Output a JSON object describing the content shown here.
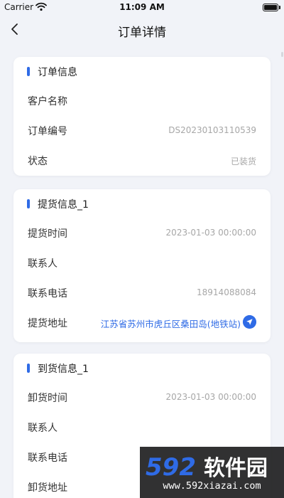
{
  "status_bar": {
    "carrier": "Carrier",
    "time": "11:09 AM",
    "wifi_icon": "wifi-icon",
    "battery_icon": "battery-icon"
  },
  "nav": {
    "title": "订单详情",
    "back_icon": "chevron-left-icon"
  },
  "order_info": {
    "title": "订单信息",
    "rows": [
      {
        "label": "客户名称",
        "value": ""
      },
      {
        "label": "订单编号",
        "value": "DS20230103110539"
      },
      {
        "label": "状态",
        "value": "已装货"
      }
    ]
  },
  "pickup_info": {
    "title": "提货信息_1",
    "rows": [
      {
        "label": "提货时间",
        "value": "2023-01-03 00:00:00"
      },
      {
        "label": "联系人",
        "value": ""
      },
      {
        "label": "联系电话",
        "value": "18914088084"
      },
      {
        "label": "提货地址",
        "value": "江苏省苏州市虎丘区桑田岛(地铁站)",
        "icon": "navigation-arrow-icon"
      }
    ]
  },
  "delivery_info": {
    "title": "到货信息_1",
    "rows": [
      {
        "label": "卸货时间",
        "value": "2023-01-03 00:00:00"
      },
      {
        "label": "联系人",
        "value": ""
      },
      {
        "label": "联系电话",
        "value": ""
      },
      {
        "label": "卸货地址",
        "value": ""
      }
    ]
  },
  "watermark": {
    "logo_text": "592软件园",
    "url": "www.592xiazai.com"
  },
  "colors": {
    "accent": "#2f6be6",
    "background": "#f1f3f8",
    "card": "#ffffff",
    "muted_text": "#a7a7a7"
  }
}
